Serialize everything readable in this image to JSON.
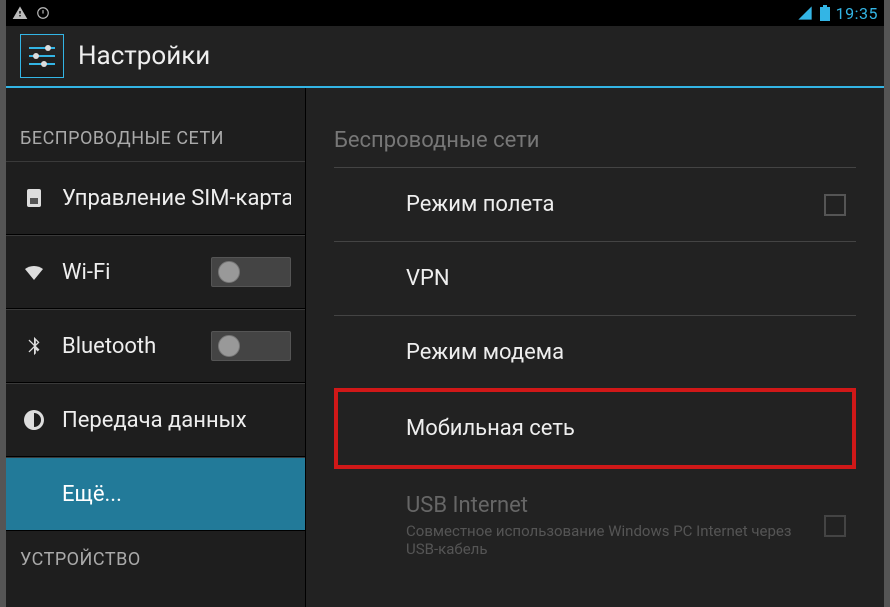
{
  "status": {
    "time": "19:35"
  },
  "title": "Настройки",
  "left": {
    "section_wireless": "БЕСПРОВОДНЫЕ СЕТИ",
    "section_device": "УСТРОЙСТВО",
    "sim": "Управление SIM-картами",
    "wifi": "Wi-Fi",
    "bluetooth": "Bluetooth",
    "data": "Передача данных",
    "more": "Ещё..."
  },
  "right": {
    "header": "Беспроводные сети",
    "airplane": "Режим полета",
    "vpn": "VPN",
    "tethering": "Режим модема",
    "mobile": "Мобильная сеть",
    "usb_title": "USB Internet",
    "usb_sub": "Совместное использование Windows PC Internet через USB-кабель"
  }
}
